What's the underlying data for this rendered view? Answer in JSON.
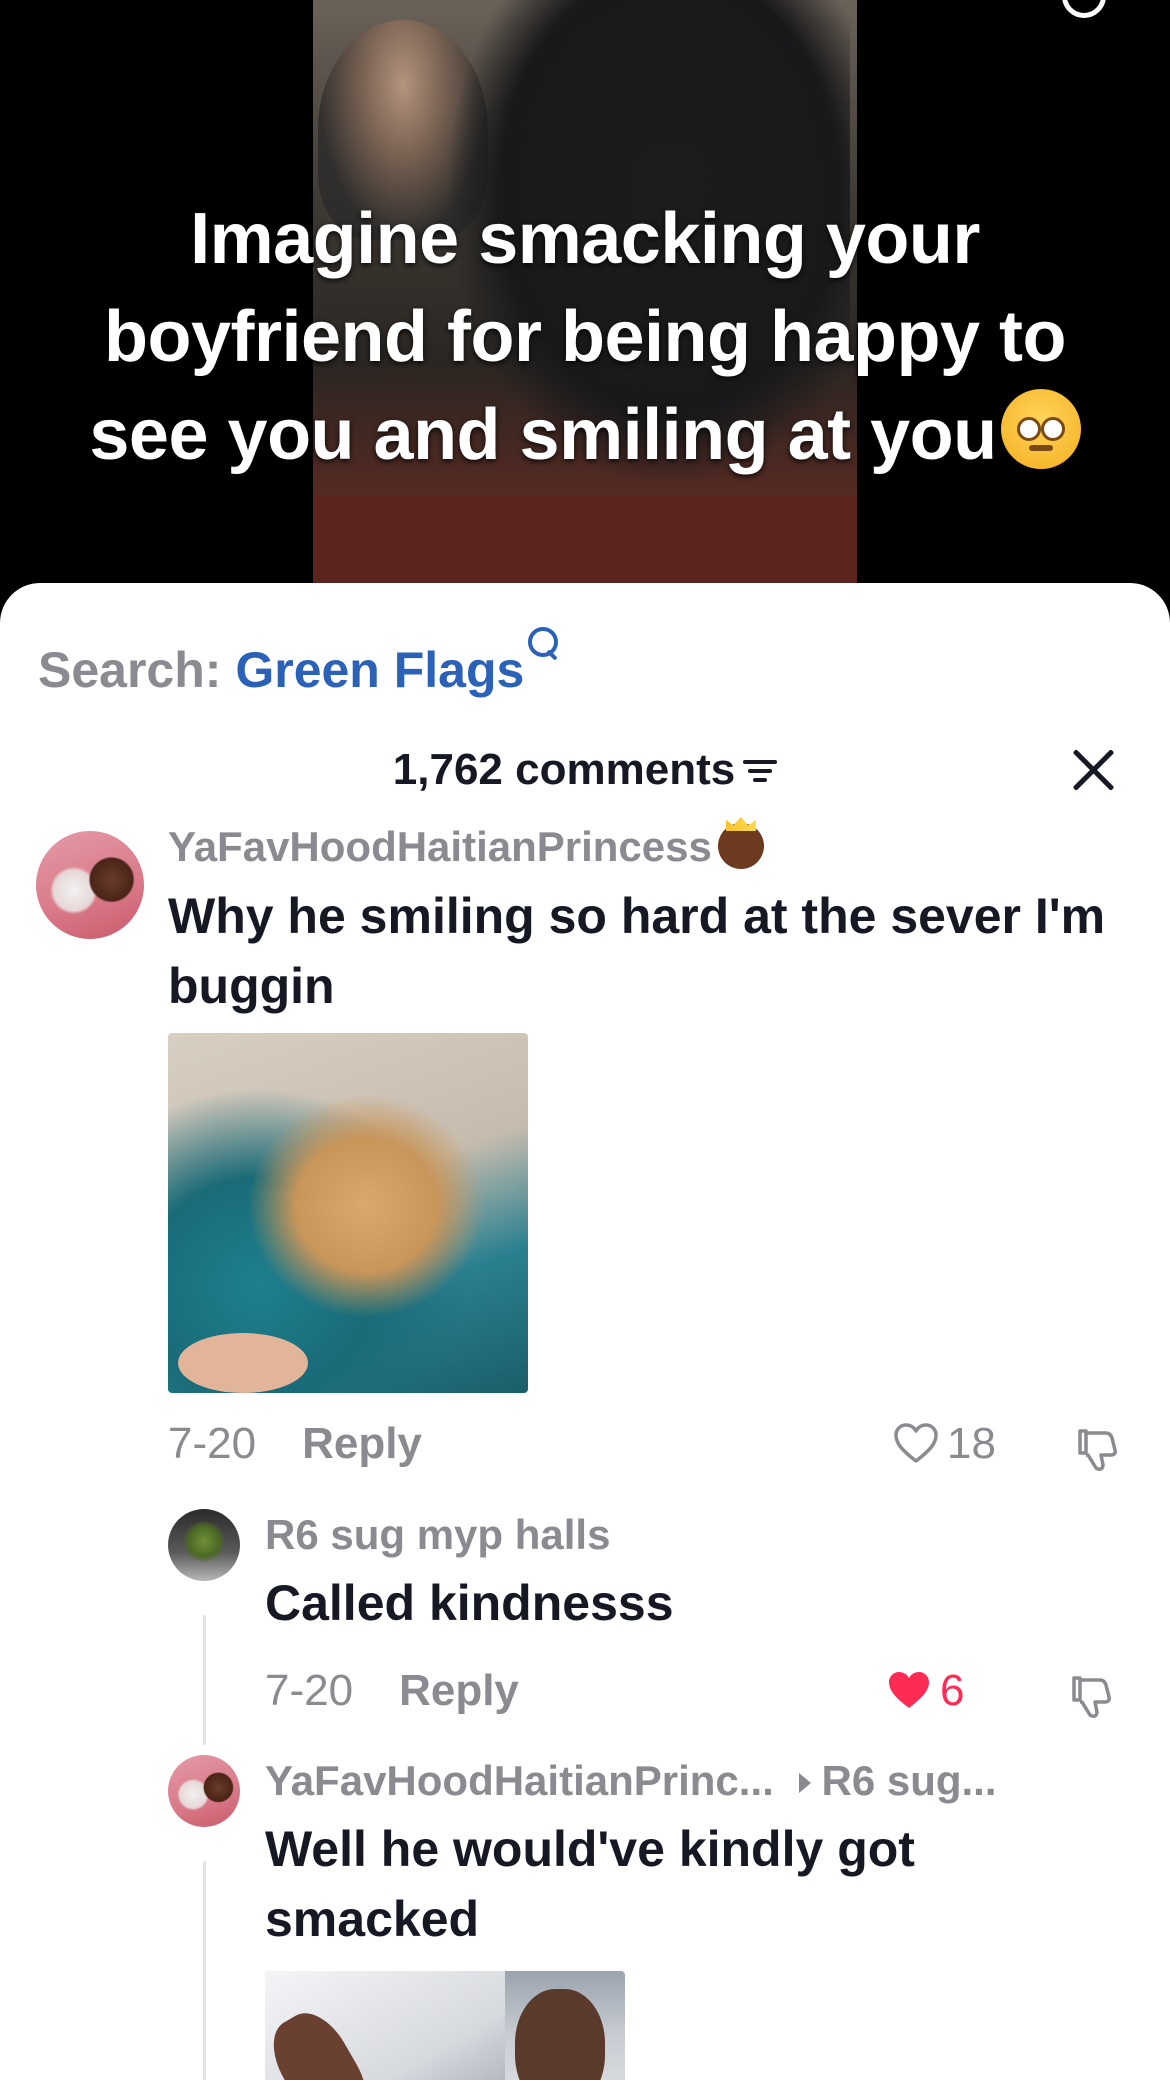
{
  "video": {
    "caption": "Imagine smacking your boyfriend for being happy to see you and smiling at you"
  },
  "sheet": {
    "search_label": "Search:",
    "search_term": "Green Flags",
    "comments_count": "1,762 comments"
  },
  "comments": [
    {
      "username": "YaFavHoodHaitianPrincess",
      "text": "Why he smiling so hard at the sever I'm buggin",
      "date": "7-20",
      "reply_label": "Reply",
      "likes": "18",
      "liked": false
    },
    {
      "username": "R6 sug myp halls",
      "text": "Called kindnesss",
      "date": "7-20",
      "reply_label": "Reply",
      "likes": "6",
      "liked": true
    },
    {
      "username": "YaFavHoodHaitianPrinc...",
      "reply_to": "R6 sug...",
      "text": "Well he would've kindly got smacked"
    }
  ],
  "colors": {
    "link_blue": "#2b62b8",
    "like_red": "#fe2c55",
    "muted_gray": "#8a8b91",
    "text_dark": "#161823"
  }
}
